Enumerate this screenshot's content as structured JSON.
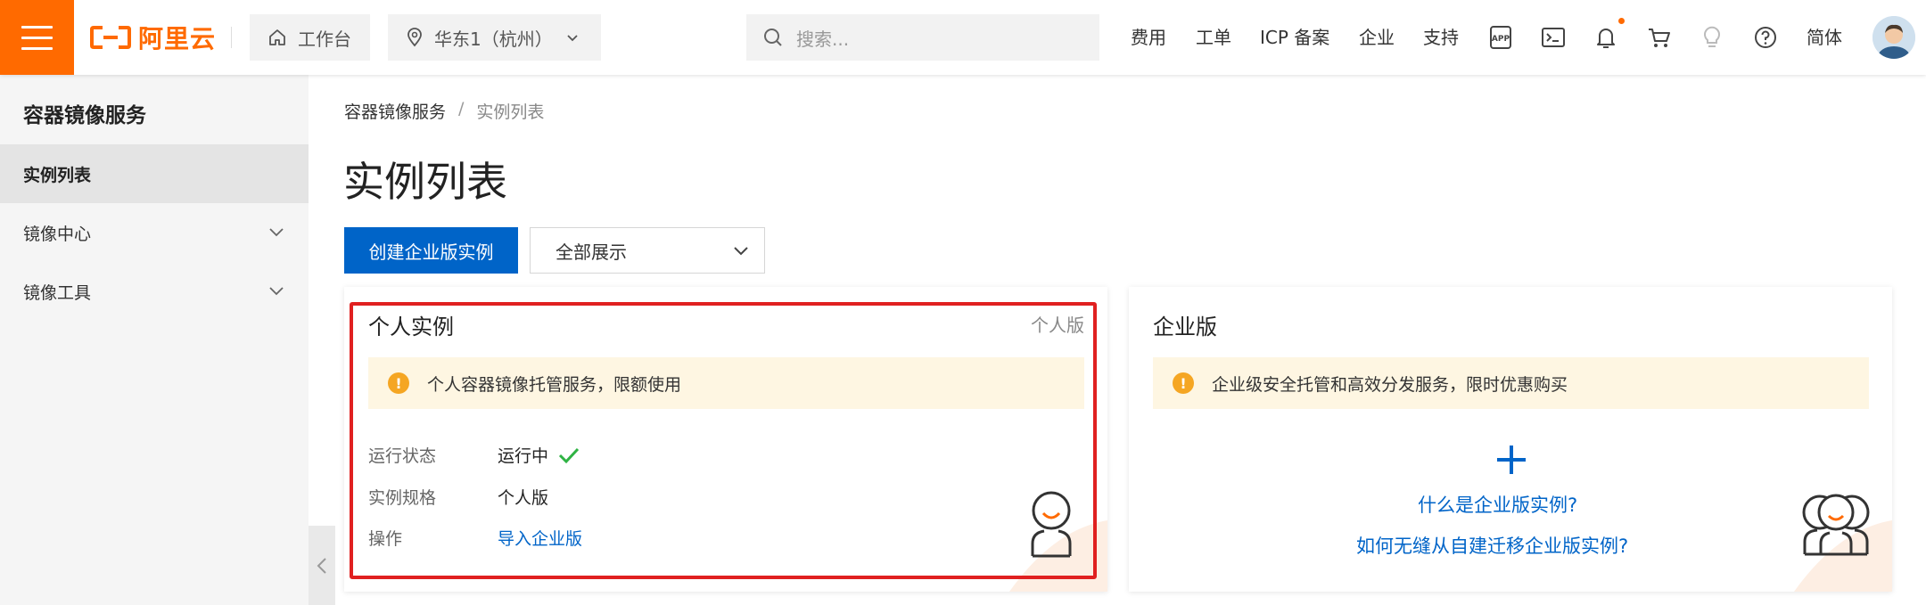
{
  "brand": {
    "logo_text": "阿里云",
    "accent": "#ff6a00"
  },
  "topbar": {
    "workbench_label": "工作台",
    "region_label": "华东1（杭州）",
    "search_placeholder": "搜索...",
    "nav": [
      "费用",
      "工单",
      "ICP 备案",
      "企业",
      "支持"
    ],
    "language": "简体",
    "icons": [
      "app-icon",
      "terminal-icon",
      "bell-icon",
      "cart-icon",
      "bulb-icon",
      "help-icon"
    ]
  },
  "sidebar": {
    "title": "容器镜像服务",
    "items": [
      {
        "label": "实例列表",
        "active": true
      },
      {
        "label": "镜像中心",
        "expandable": true
      },
      {
        "label": "镜像工具",
        "expandable": true
      }
    ]
  },
  "breadcrumb": {
    "parent": "容器镜像服务",
    "separator": "/",
    "current": "实例列表"
  },
  "page": {
    "title": "实例列表",
    "create_button": "创建企业版实例",
    "filter_select": "全部展示"
  },
  "cards": {
    "personal": {
      "title": "个人实例",
      "tag": "个人版",
      "notice": "个人容器镜像托管服务，限额使用",
      "rows": [
        {
          "key": "运行状态",
          "value": "运行中"
        },
        {
          "key": "实例规格",
          "value": "个人版"
        },
        {
          "key": "操作",
          "value": "导入企业版"
        }
      ]
    },
    "enterprise": {
      "title": "企业版",
      "notice": "企业级安全托管和高效分发服务，限时优惠购买",
      "link_what": "什么是企业版实例?",
      "link_migrate": "如何无缝从自建迁移企业版实例?"
    }
  },
  "colors": {
    "primary": "#0064c8",
    "success": "#2fb344",
    "warning": "#f5a623",
    "highlight": "#e02020"
  }
}
